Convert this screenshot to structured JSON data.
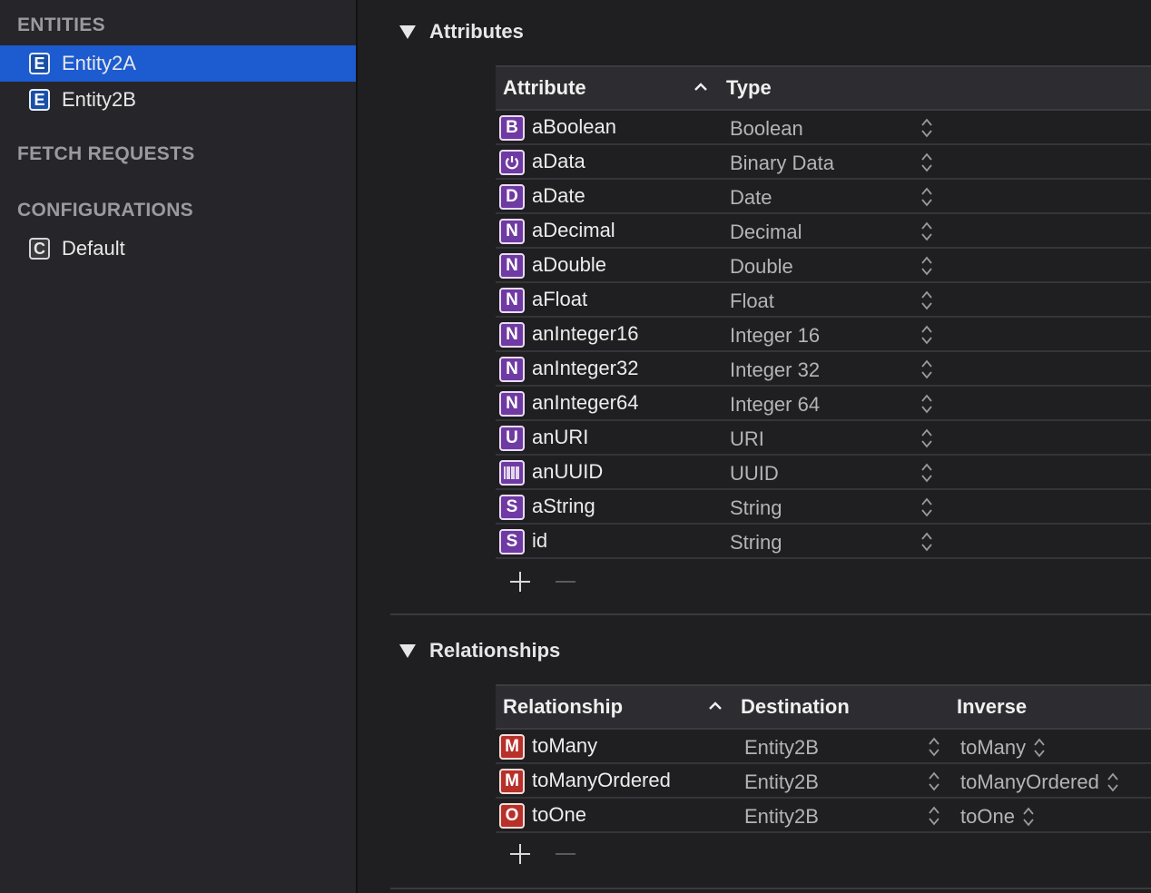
{
  "sidebar": {
    "entities_header": "ENTITIES",
    "entities": [
      {
        "label": "Entity2A",
        "icon": "E",
        "selected": true
      },
      {
        "label": "Entity2B",
        "icon": "E",
        "selected": false
      }
    ],
    "fetch_requests_header": "FETCH REQUESTS",
    "configurations_header": "CONFIGURATIONS",
    "configurations": [
      {
        "label": "Default",
        "icon": "C"
      }
    ]
  },
  "attributes": {
    "title": "Attributes",
    "col_attribute": "Attribute",
    "col_type": "Type",
    "rows": [
      {
        "icon": "B",
        "name": "aBoolean",
        "type": "Boolean"
      },
      {
        "icon": "power",
        "name": "aData",
        "type": "Binary Data"
      },
      {
        "icon": "D",
        "name": "aDate",
        "type": "Date"
      },
      {
        "icon": "N",
        "name": "aDecimal",
        "type": "Decimal"
      },
      {
        "icon": "N",
        "name": "aDouble",
        "type": "Double"
      },
      {
        "icon": "N",
        "name": "aFloat",
        "type": "Float"
      },
      {
        "icon": "N",
        "name": "anInteger16",
        "type": "Integer 16"
      },
      {
        "icon": "N",
        "name": "anInteger32",
        "type": "Integer 32"
      },
      {
        "icon": "N",
        "name": "anInteger64",
        "type": "Integer 64"
      },
      {
        "icon": "U",
        "name": "anURI",
        "type": "URI"
      },
      {
        "icon": "barcode",
        "name": "anUUID",
        "type": "UUID"
      },
      {
        "icon": "S",
        "name": "aString",
        "type": "String"
      },
      {
        "icon": "S",
        "name": "id",
        "type": "String"
      }
    ]
  },
  "relationships": {
    "title": "Relationships",
    "col_relationship": "Relationship",
    "col_destination": "Destination",
    "col_inverse": "Inverse",
    "rows": [
      {
        "icon": "M",
        "name": "toMany",
        "destination": "Entity2B",
        "inverse": "toMany"
      },
      {
        "icon": "M",
        "name": "toManyOrdered",
        "destination": "Entity2B",
        "inverse": "toManyOrdered"
      },
      {
        "icon": "O",
        "name": "toOne",
        "destination": "Entity2B",
        "inverse": "toOne"
      }
    ]
  },
  "colors": {
    "selection": "#1c5bd0",
    "attribute_icon": "#6f3aa3",
    "relationship_icon": "#b8302a"
  }
}
